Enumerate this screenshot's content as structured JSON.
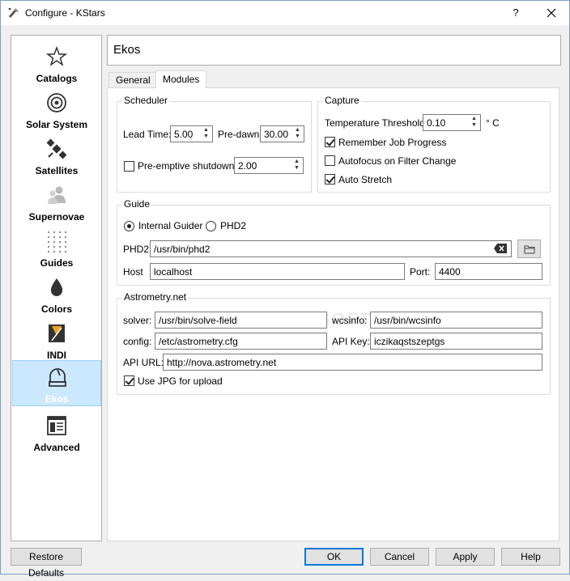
{
  "window": {
    "title": "Configure - KStars",
    "help_label": "?",
    "close_label": "✕"
  },
  "sidebar": {
    "items": [
      {
        "label": "Catalogs",
        "icon": "star-icon"
      },
      {
        "label": "Solar System",
        "icon": "target-icon"
      },
      {
        "label": "Satellites",
        "icon": "satellite-icon"
      },
      {
        "label": "Supernovae",
        "icon": "people-icon"
      },
      {
        "label": "Guides",
        "icon": "dots-grid-icon"
      },
      {
        "label": "Colors",
        "icon": "drop-icon"
      },
      {
        "label": "INDI",
        "icon": "indi-icon"
      },
      {
        "label": "Ekos",
        "icon": "dome-icon"
      },
      {
        "label": "Advanced",
        "icon": "window-icon"
      }
    ],
    "selected": "Ekos"
  },
  "header": {
    "title": "Ekos"
  },
  "tabs": [
    {
      "label": "General"
    },
    {
      "label": "Modules"
    }
  ],
  "active_tab": "Modules",
  "scheduler": {
    "title": "Scheduler",
    "lead_time_label": "Lead Time:",
    "lead_time_value": "5.00",
    "pre_dawn_label": "Pre-dawn",
    "pre_dawn_value": "30.00",
    "preemptive_label": "Pre-emptive shutdown",
    "preemptive_checked": false,
    "preemptive_value": "2.00"
  },
  "capture": {
    "title": "Capture",
    "temp_label": "Temperature Threshold:",
    "temp_value": "0.10",
    "temp_unit": "° C",
    "remember_label": "Remember Job Progress",
    "remember_checked": true,
    "autofocus_label": "Autofocus on Filter Change",
    "autofocus_checked": false,
    "autostretch_label": "Auto Stretch",
    "autostretch_checked": true
  },
  "guide": {
    "title": "Guide",
    "internal_label": "Internal Guider",
    "phd2_radio_label": "PHD2",
    "selected": "Internal Guider",
    "phd2_path_label": "PHD2",
    "phd2_path": "/usr/bin/phd2",
    "host_label": "Host",
    "host_value": "localhost",
    "port_label": "Port:",
    "port_value": "4400"
  },
  "astrometry": {
    "title": "Astrometry.net",
    "solver_label": "solver:",
    "solver_value": "/usr/bin/solve-field",
    "wcsinfo_label": "wcsinfo:",
    "wcsinfo_value": "/usr/bin/wcsinfo",
    "config_label": "config:",
    "config_value": "/etc/astrometry.cfg",
    "apikey_label": "API Key:",
    "apikey_value": "iczikaqstszeptgs",
    "apiurl_label": "API URL:",
    "apiurl_value": "http://nova.astrometry.net",
    "usejpg_label": "Use JPG for upload",
    "usejpg_checked": true
  },
  "watermark": "SOFTPEDIA",
  "buttons": {
    "restore_defaults": "Restore Defaults",
    "ok": "OK",
    "cancel": "Cancel",
    "apply": "Apply",
    "help": "Help"
  },
  "colors": {
    "selection_bg": "#cce8ff",
    "default_button_border": "#0078d7"
  }
}
